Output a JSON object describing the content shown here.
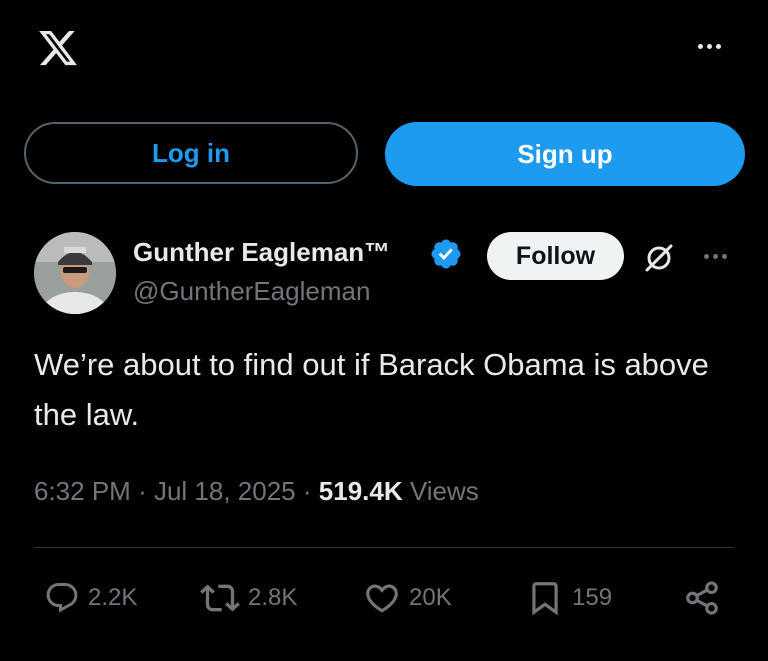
{
  "header": {
    "logo_icon": "x-logo-icon",
    "more_icon": "more-horizontal-icon"
  },
  "auth": {
    "login_label": "Log in",
    "signup_label": "Sign up"
  },
  "post": {
    "author": {
      "name": "Gunther Eagleman™",
      "handle": "@GuntherEagleman",
      "verified": true,
      "verified_color": "#1d9bf0"
    },
    "follow_label": "Follow",
    "grok_icon": "grok-icon",
    "text": "We’re about to find out if Barack Obama is above the law.",
    "time": "6:32 PM",
    "date": "Jul 18, 2025",
    "separator": "·",
    "views_count": "519.4K",
    "views_label": "Views",
    "actions": {
      "replies": "2.2K",
      "reposts": "2.8K",
      "likes": "20K",
      "bookmarks": "159"
    }
  },
  "colors": {
    "background": "#000000",
    "accent": "#1d9bf0",
    "text_primary": "#e7e9ea",
    "text_secondary": "#71767b"
  }
}
